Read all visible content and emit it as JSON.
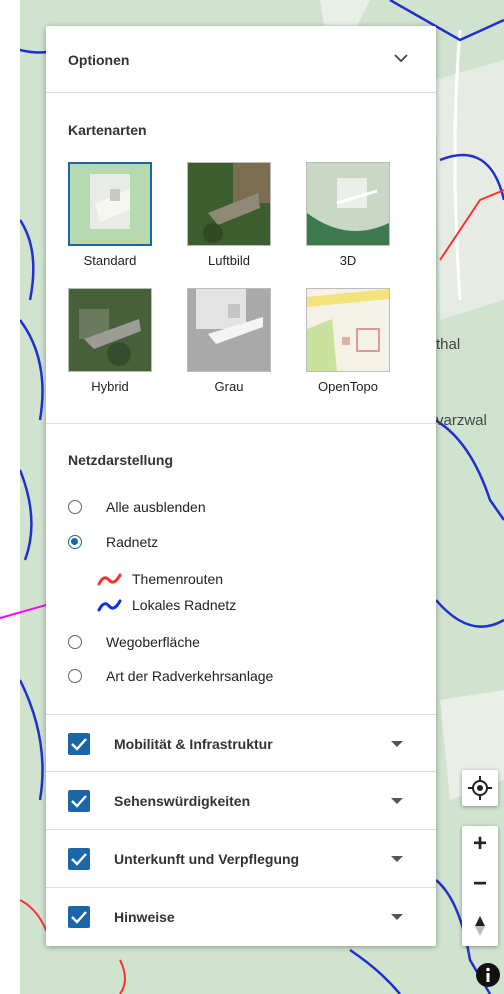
{
  "map": {
    "labels": [
      "thal",
      "varzwal"
    ]
  },
  "panel": {
    "title": "Optionen",
    "map_types": {
      "title": "Kartenarten",
      "items": [
        {
          "label": "Standard",
          "selected": true
        },
        {
          "label": "Luftbild",
          "selected": false
        },
        {
          "label": "3D",
          "selected": false
        },
        {
          "label": "Hybrid",
          "selected": false
        },
        {
          "label": "Grau",
          "selected": false
        },
        {
          "label": "OpenTopo",
          "selected": false
        }
      ]
    },
    "network": {
      "title": "Netzdarstellung",
      "options": [
        {
          "label": "Alle ausblenden",
          "checked": false
        },
        {
          "label": "Radnetz",
          "checked": true
        },
        {
          "label": "Wegoberfläche",
          "checked": false
        },
        {
          "label": "Art der Radverkehrsanlage",
          "checked": false
        }
      ],
      "legend": [
        {
          "label": "Themenrouten",
          "color": "#ff3030"
        },
        {
          "label": "Lokales Radnetz",
          "color": "#1030e0"
        }
      ]
    },
    "layers": [
      {
        "label": "Mobilität & Infrastruktur",
        "checked": true
      },
      {
        "label": "Sehenswürdigkeiten",
        "checked": true
      },
      {
        "label": "Unterkunft und Verpflegung",
        "checked": true
      },
      {
        "label": "Hinweise",
        "checked": true
      }
    ]
  },
  "controls": {
    "locate": "locate-icon",
    "zoom_in": "+",
    "zoom_out": "−",
    "info": "info-icon"
  },
  "colors": {
    "accent": "#1a66a8",
    "map_green": "#cfe3cf",
    "route_blue": "#1030e0",
    "route_red": "#ff3030",
    "annotation_arrow": "#ff00ff"
  }
}
